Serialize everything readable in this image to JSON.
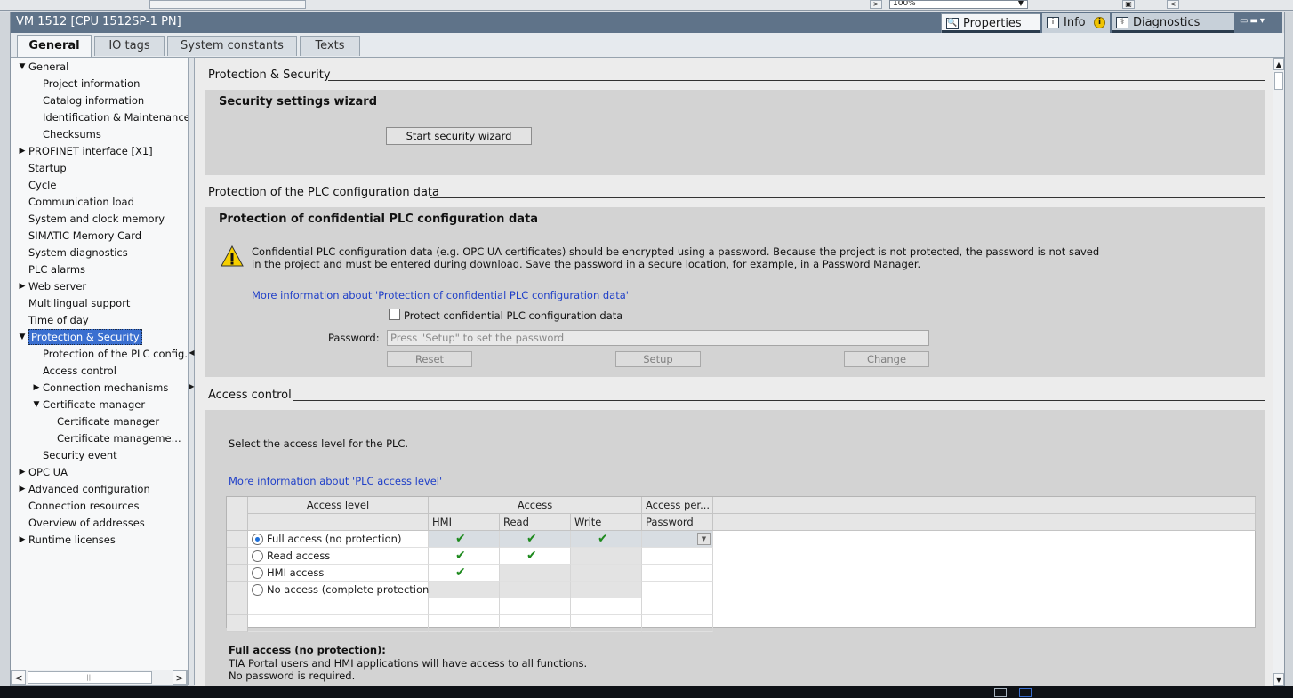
{
  "topstrip": {
    "zoom_value": "100%"
  },
  "window": {
    "title": "VM 1512 [CPU 1512SP-1 PN]",
    "tabs": {
      "properties": "Properties",
      "info": "Info",
      "diagnostics": "Diagnostics"
    }
  },
  "subtabs": [
    "General",
    "IO tags",
    "System constants",
    "Texts"
  ],
  "nav": [
    {
      "label": "General",
      "level": 0,
      "toggle": "expanded"
    },
    {
      "label": "Project information",
      "level": 1
    },
    {
      "label": "Catalog information",
      "level": 1
    },
    {
      "label": "Identification & Maintenance",
      "level": 1
    },
    {
      "label": "Checksums",
      "level": 1
    },
    {
      "label": "PROFINET interface [X1]",
      "level": 0,
      "toggle": "collapsed"
    },
    {
      "label": "Startup",
      "level": 0
    },
    {
      "label": "Cycle",
      "level": 0
    },
    {
      "label": "Communication load",
      "level": 0
    },
    {
      "label": "System and clock memory",
      "level": 0
    },
    {
      "label": "SIMATIC Memory Card",
      "level": 0
    },
    {
      "label": "System diagnostics",
      "level": 0
    },
    {
      "label": "PLC alarms",
      "level": 0
    },
    {
      "label": "Web server",
      "level": 0,
      "toggle": "collapsed"
    },
    {
      "label": "Multilingual support",
      "level": 0
    },
    {
      "label": "Time of day",
      "level": 0
    },
    {
      "label": "Protection & Security",
      "level": 0,
      "toggle": "expanded",
      "selected": true
    },
    {
      "label": "Protection of the PLC config...",
      "level": 1
    },
    {
      "label": "Access control",
      "level": 1
    },
    {
      "label": "Connection mechanisms",
      "level": 1,
      "toggle": "collapsed"
    },
    {
      "label": "Certificate manager",
      "level": 1,
      "toggle": "expanded"
    },
    {
      "label": "Certificate manager",
      "level": 2
    },
    {
      "label": "Certificate manageme...",
      "level": 2
    },
    {
      "label": "Security event",
      "level": 1
    },
    {
      "label": "OPC UA",
      "level": 0,
      "toggle": "collapsed"
    },
    {
      "label": "Advanced configuration",
      "level": 0,
      "toggle": "collapsed"
    },
    {
      "label": "Connection resources",
      "level": 0
    },
    {
      "label": "Overview of addresses",
      "level": 0
    },
    {
      "label": "Runtime licenses",
      "level": 0,
      "toggle": "collapsed"
    }
  ],
  "content": {
    "section1_title": "Protection & Security",
    "wizard": {
      "title": "Security settings wizard",
      "button": "Start security wizard"
    },
    "section2_title": "Protection of the PLC configuration data",
    "confidential": {
      "title": "Protection of confidential PLC configuration data",
      "warning_line1": "Confidential PLC configuration data (e.g. OPC UA certificates) should be encrypted using a password. Because the project is not protected, the password is not saved",
      "warning_line2": "in the project and must be entered during download. Save the password in a secure location, for example, in a Password Manager.",
      "link": "More information about 'Protection of confidential PLC configuration data'",
      "checkbox_label": "Protect confidential PLC configuration data",
      "password_label": "Password:",
      "password_placeholder": "Press \"Setup\" to set the password",
      "reset": "Reset",
      "setup": "Setup",
      "change": "Change"
    },
    "section3_title": "Access control",
    "access": {
      "instruction": "Select the access level for the PLC.",
      "link": "More information about 'PLC access level'",
      "headers": {
        "access_level": "Access level",
        "access": "Access",
        "access_permission": "Access per...",
        "hmi": "HMI",
        "read": "Read",
        "write": "Write",
        "password": "Password"
      },
      "rows": [
        {
          "label": "Full access (no protection)",
          "selected": true,
          "hmi": true,
          "read": true,
          "write": true
        },
        {
          "label": "Read access",
          "selected": false,
          "hmi": true,
          "read": true,
          "write": false
        },
        {
          "label": "HMI access",
          "selected": false,
          "hmi": true,
          "read": false,
          "write": false
        },
        {
          "label": "No access (complete protection)",
          "selected": false,
          "hmi": false,
          "read": false,
          "write": false
        }
      ],
      "description_title": "Full access (no protection):",
      "description_line1": "TIA Portal users and HMI applications will have access to all functions.",
      "description_line2": "No password is required."
    }
  }
}
